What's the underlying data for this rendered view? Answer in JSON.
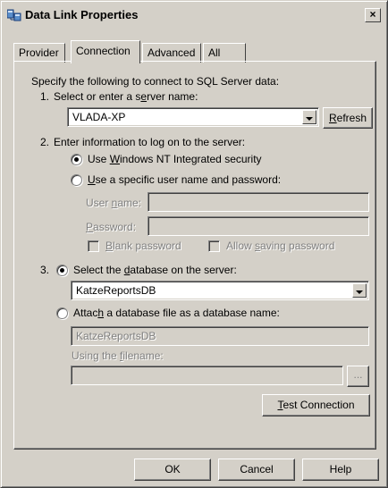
{
  "window": {
    "title": "Data Link Properties",
    "close_label": "×"
  },
  "tabs": [
    {
      "label": "Provider",
      "active": false
    },
    {
      "label": "Connection",
      "active": true
    },
    {
      "label": "Advanced",
      "active": false
    },
    {
      "label": "All",
      "active": false
    }
  ],
  "connection": {
    "intro": "Specify the following to connect to SQL Server data:",
    "step1": {
      "number": "1.",
      "label_pre": "Select or enter a s",
      "label_u": "e",
      "label_post": "rver name:",
      "server_value": "VLADA-XP",
      "refresh_pre": "",
      "refresh_u": "R",
      "refresh_post": "efresh"
    },
    "step2": {
      "number": "2.",
      "label": "Enter information to log on to the server:",
      "radio_nt_pre": "Use ",
      "radio_nt_u": "W",
      "radio_nt_post": "indows NT Integrated security",
      "radio_nt_checked": true,
      "radio_specific_pre": "",
      "radio_specific_u": "U",
      "radio_specific_post": "se a specific user name and password:",
      "radio_specific_checked": false,
      "user_label_pre": "User ",
      "user_label_u": "n",
      "user_label_post": "ame:",
      "user_value": "",
      "password_label_pre": "",
      "password_label_u": "P",
      "password_label_post": "assword:",
      "password_value": "",
      "blank_password_pre": "",
      "blank_password_u": "B",
      "blank_password_post": "lank password",
      "blank_password_checked": false,
      "allow_saving_pre": "Allow ",
      "allow_saving_u": "s",
      "allow_saving_post": "aving password",
      "allow_saving_checked": false
    },
    "step3": {
      "number": "3.",
      "radio_select_pre": "Select the ",
      "radio_select_u": "d",
      "radio_select_post": "atabase on the server:",
      "radio_select_checked": true,
      "database_value": "KatzeReportsDB",
      "radio_attach_pre": "Attac",
      "radio_attach_u": "h",
      "radio_attach_post": " a database file as a database name:",
      "radio_attach_checked": false,
      "attach_name_value": "KatzeReportsDB",
      "filename_label_pre": "Using the ",
      "filename_label_u": "f",
      "filename_label_post": "ilename:",
      "filename_value": "",
      "browse_label": "...",
      "test_pre": "",
      "test_u": "T",
      "test_post": "est Connection"
    }
  },
  "footer": {
    "ok_label": "OK",
    "cancel_label": "Cancel",
    "help_label": "Help"
  }
}
